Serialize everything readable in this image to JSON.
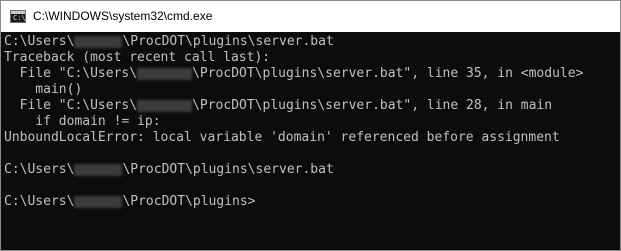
{
  "window": {
    "title": "C:\\WINDOWS\\system32\\cmd.exe",
    "icon": "cmd-console-icon",
    "icon_text": "C:\\"
  },
  "console": {
    "lines": [
      {
        "pre": "C:\\Users\\",
        "post": "\\ProcDOT\\plugins\\server.bat",
        "redacted": true
      },
      {
        "text": "Traceback (most recent call last):"
      },
      {
        "pre": "  File \"C:\\Users\\",
        "post": "\\ProcDOT\\plugins\\server.bat\", line 35, in <module>",
        "redacted": true
      },
      {
        "text": "    main()"
      },
      {
        "pre": "  File \"C:\\Users\\",
        "post": "\\ProcDOT\\plugins\\server.bat\", line 28, in main",
        "redacted": true
      },
      {
        "text": "    if domain != ip:"
      },
      {
        "text": "UnboundLocalError: local variable 'domain' referenced before assignment"
      },
      {
        "text": ""
      },
      {
        "pre": "C:\\Users\\",
        "post": "\\ProcDOT\\plugins\\server.bat",
        "redacted": true
      },
      {
        "text": ""
      },
      {
        "pre": "C:\\Users\\",
        "post": "\\ProcDOT\\plugins>",
        "redacted": true
      }
    ]
  }
}
